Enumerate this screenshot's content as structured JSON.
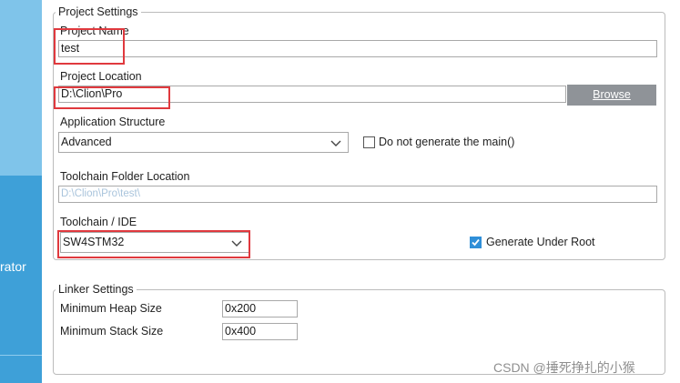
{
  "sidebar": {
    "partial_label": "rator"
  },
  "project_settings": {
    "title": "Project Settings",
    "project_name": {
      "label": "Project Name",
      "value": "test"
    },
    "project_location": {
      "label": "Project Location",
      "value": "D:\\Clion\\Pro",
      "browse_label": "Browse"
    },
    "application_structure": {
      "label": "Application Structure",
      "selected": "Advanced",
      "do_not_generate_main": {
        "label": "Do not generate the main()",
        "checked": false
      }
    },
    "toolchain_folder": {
      "label": "Toolchain Folder Location",
      "value": "D:\\Clion\\Pro\\test\\"
    },
    "toolchain_ide": {
      "label": "Toolchain / IDE",
      "selected": "SW4STM32",
      "generate_under_root": {
        "label": "Generate Under Root",
        "checked": true
      }
    }
  },
  "linker_settings": {
    "title": "Linker Settings",
    "min_heap": {
      "label": "Minimum Heap Size",
      "value": "0x200"
    },
    "min_stack": {
      "label": "Minimum Stack Size",
      "value": "0x400"
    }
  },
  "watermark": "CSDN @捶死挣扎的小猴",
  "colors": {
    "sidebar": "#3ea0d8",
    "sidebar_light": "#7fc4ea",
    "browse_button": "#8f9398",
    "highlight": "#e0393e",
    "checkbox_checked": "#2f8fd8"
  },
  "icons": {
    "dropdown": "chevron-down-icon",
    "check": "check-icon"
  }
}
